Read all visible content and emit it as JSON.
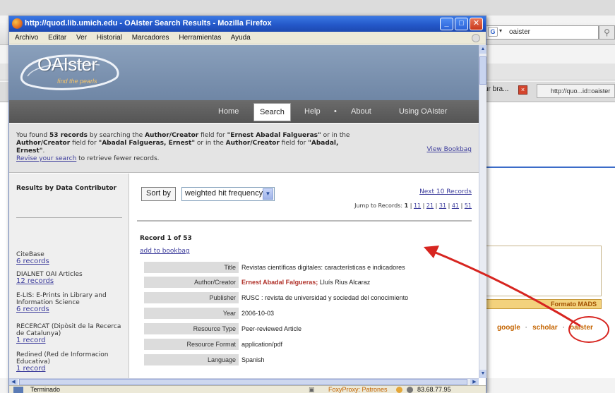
{
  "background": {
    "search_value": "oaister",
    "tab1_label": "ur bra...",
    "tab2_label": "http://quo...id=oaister",
    "mads_label": "Formato MADS",
    "links": [
      "google",
      "scholar",
      "oaister"
    ],
    "link_sep": "·"
  },
  "window": {
    "title": "http://quod.lib.umich.edu - OAIster Search Results - Mozilla Firefox",
    "controls": {
      "minimize": "_",
      "maximize": "□",
      "close": "✕"
    },
    "menu": [
      "Archivo",
      "Editar",
      "Ver",
      "Historial",
      "Marcadores",
      "Herramientas",
      "Ayuda"
    ]
  },
  "oaister": {
    "logo": "OAIster",
    "tagline": "find the pearls",
    "nav": [
      "Home",
      "Search",
      "Help",
      "About",
      "Using OAIster"
    ],
    "nav_active": "Search",
    "nav_dot": "•"
  },
  "found": {
    "p1": "You found ",
    "count": "53 records",
    "p2": " by searching the ",
    "field1": "Author/Creator",
    "p3": " field for ",
    "q1": "\"Ernest Abadal Falgueras\"",
    "p4": " or in the ",
    "field2": "Author/Creator",
    "p5": " field for ",
    "q2": "\"Abadal Falgueras, Ernest\"",
    "p6": " or in the ",
    "field3": "Author/Creator",
    "p7": " field for ",
    "q3": "\"Abadal, Ernest\"",
    "p8": ".",
    "revise_link": "Revise your search",
    "p9": " to retrieve fewer records.",
    "view_bookbag": "View Bookbag"
  },
  "sidebar": {
    "heading": "Results by Data Contributor",
    "entries": [
      {
        "name": "CiteBase",
        "count": "6 records"
      },
      {
        "name": "DIALNET OAI Articles",
        "count": "12 records"
      },
      {
        "name": "E-LIS: E-Prints in Library and Information Science",
        "count": "6 records"
      },
      {
        "name": "RECERCAT (Dipòsit de la Recerca de Catalunya)",
        "count": "1 record"
      },
      {
        "name": "Redined (Red de Informacion Educativa)",
        "count": "1 record"
      }
    ]
  },
  "results": {
    "sort_label": "Sort by",
    "sort_value": "weighted hit frequency",
    "next10": "Next 10 Records",
    "jump_label": "Jump to Records:",
    "jump_pages": [
      "1",
      "11",
      "21",
      "31",
      "41",
      "51"
    ],
    "record_title": "Record 1 of 53",
    "add_bookbag": "add to bookbag",
    "fields": [
      {
        "label": "Title",
        "value": "Revistas científicas digitales: características e indicadores"
      },
      {
        "label": "Author/Creator",
        "value": "Ernest Abadal Falgueras; Lluís Rius Alcaraz"
      },
      {
        "label": "Publisher",
        "value": "RUSC : revista de universidad y sociedad del conocimiento"
      },
      {
        "label": "Year",
        "value": "2006-10-03"
      },
      {
        "label": "Resource Type",
        "value": "Peer-reviewed Article"
      },
      {
        "label": "Resource Format",
        "value": "application/pdf"
      },
      {
        "label": "Language",
        "value": "Spanish"
      }
    ]
  },
  "statusbar": {
    "text": "Terminado",
    "proxy": "FoxyProxy: Patrones",
    "ip": "83.68.77.95"
  },
  "colors": {
    "titlebar": "#2458c9",
    "oaister_header": "#7b91ae",
    "nav_bar": "#5f5f5f",
    "link": "#3d3d9c",
    "author_highlight": "#b0322a",
    "annotation_red": "#d72520"
  }
}
